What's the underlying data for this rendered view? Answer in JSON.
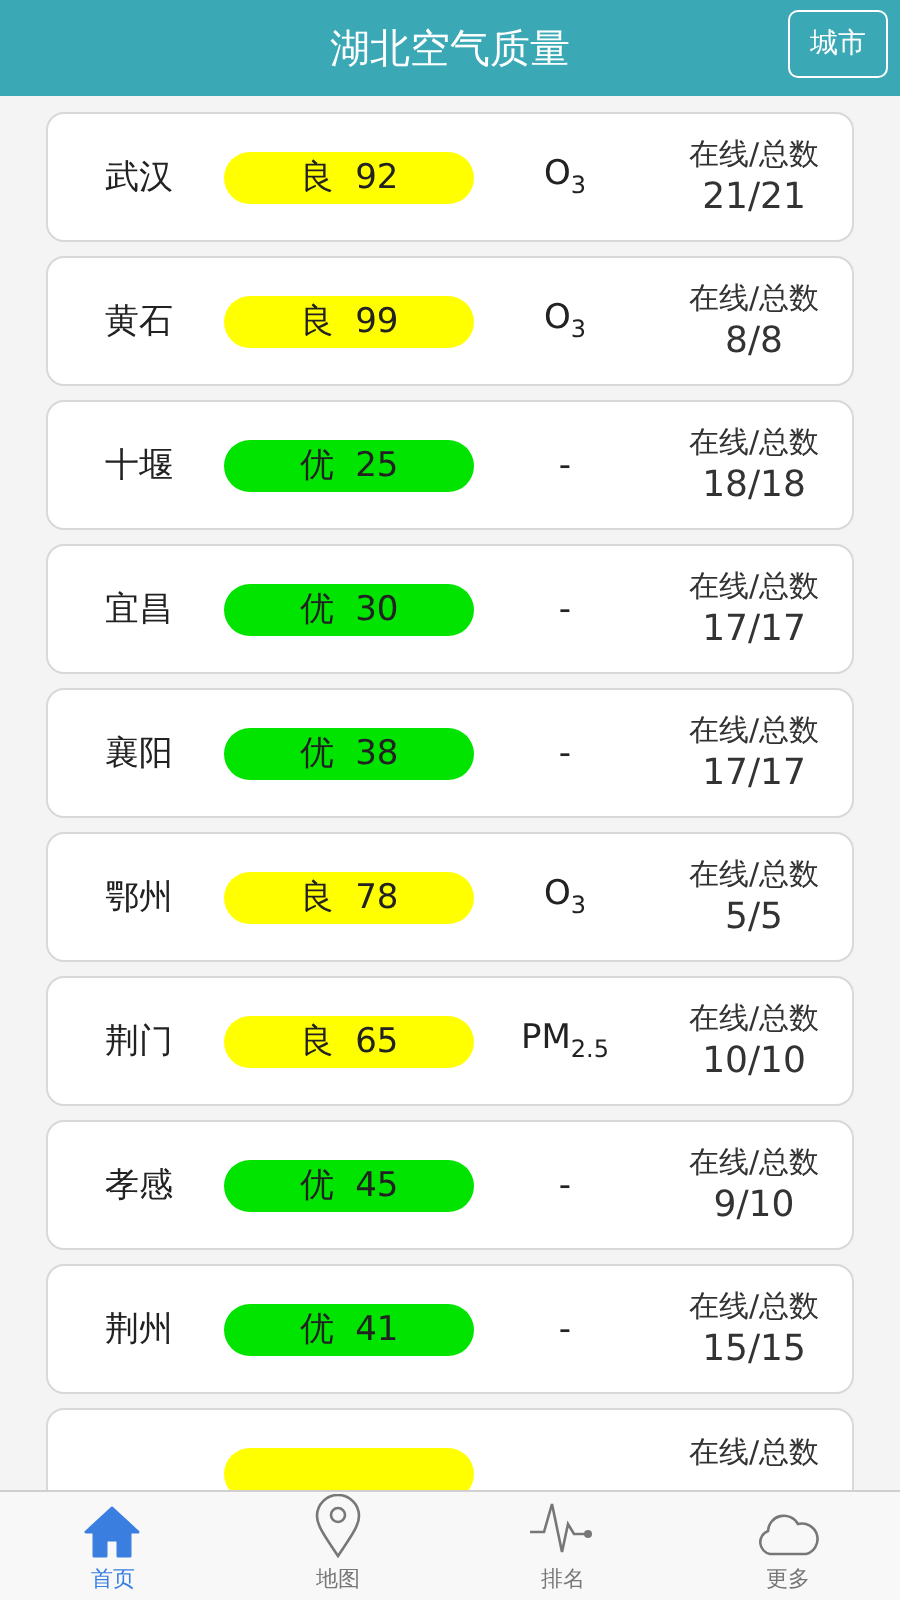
{
  "header": {
    "title": "湖北空气质量",
    "city_button": "城市"
  },
  "rows": [
    {
      "city": "武汉",
      "level": "良",
      "aqi": "92",
      "color": "#ffff00",
      "pollutant": "O$_{3}$",
      "label": "在线/总数",
      "count": "21/21"
    },
    {
      "city": "黄石",
      "level": "良",
      "aqi": "99",
      "color": "#ffff00",
      "pollutant": "O$_{3}$",
      "label": "在线/总数",
      "count": "8/8"
    },
    {
      "city": "十堰",
      "level": "优",
      "aqi": "25",
      "color": "#00e400",
      "pollutant": "-",
      "label": "在线/总数",
      "count": "18/18"
    },
    {
      "city": "宜昌",
      "level": "优",
      "aqi": "30",
      "color": "#00e400",
      "pollutant": "-",
      "label": "在线/总数",
      "count": "17/17"
    },
    {
      "city": "襄阳",
      "level": "优",
      "aqi": "38",
      "color": "#00e400",
      "pollutant": "-",
      "label": "在线/总数",
      "count": "17/17"
    },
    {
      "city": "鄂州",
      "level": "良",
      "aqi": "78",
      "color": "#ffff00",
      "pollutant": "O$_{3}$",
      "label": "在线/总数",
      "count": "5/5"
    },
    {
      "city": "荆门",
      "level": "良",
      "aqi": "65",
      "color": "#ffff00",
      "pollutant": "PM$_{2.5}$",
      "label": "在线/总数",
      "count": "10/10"
    },
    {
      "city": "孝感",
      "level": "优",
      "aqi": "45",
      "color": "#00e400",
      "pollutant": "-",
      "label": "在线/总数",
      "count": "9/10"
    },
    {
      "city": "荆州",
      "level": "优",
      "aqi": "41",
      "color": "#00e400",
      "pollutant": "-",
      "label": "在线/总数",
      "count": "15/15"
    },
    {
      "color": "#ffff00",
      "label": "在线/总数"
    }
  ],
  "tabs": [
    {
      "kind": "home",
      "label": "首页",
      "selected": true
    },
    {
      "kind": "pin",
      "label": "地图",
      "selected": false
    },
    {
      "kind": "pulse",
      "label": "排名",
      "selected": false
    },
    {
      "kind": "cloud",
      "label": "更多",
      "selected": false
    }
  ]
}
